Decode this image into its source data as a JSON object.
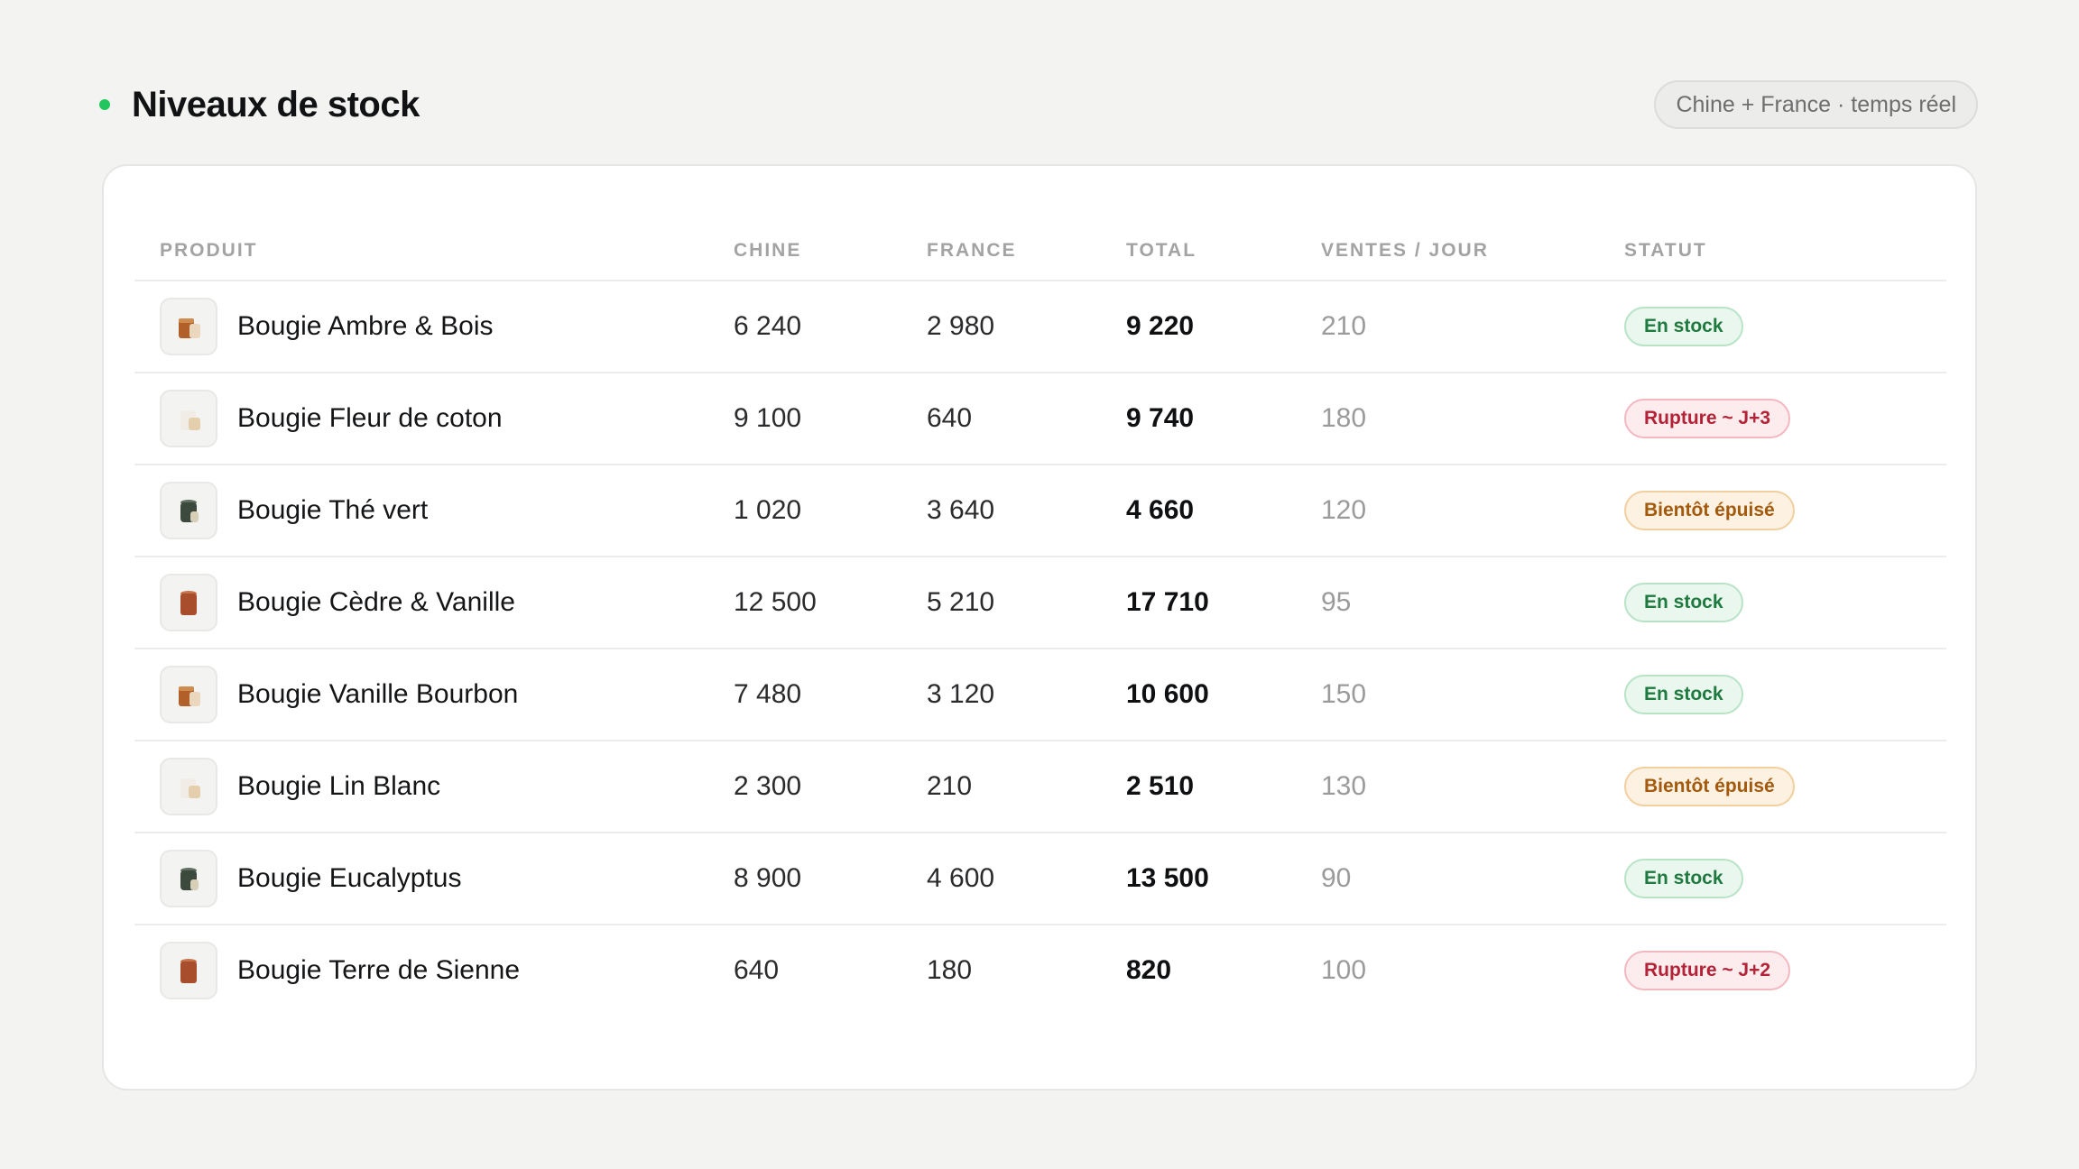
{
  "header": {
    "title": "Niveaux de stock",
    "source_pill": "Chine + France · temps réel",
    "status_dot_color": "#22c55e"
  },
  "table": {
    "columns": {
      "product": "PRODUIT",
      "china": "CHINE",
      "france": "FRANCE",
      "total": "TOTAL",
      "sales_per_day": "VENTES / JOUR",
      "status": "STATUT"
    },
    "rows": [
      {
        "product": "Bougie Ambre & Bois",
        "thumb": "amber",
        "china": "6 240",
        "france": "2 980",
        "total": "9 220",
        "sales": "210",
        "status": "En stock",
        "status_kind": "ok"
      },
      {
        "product": "Bougie Fleur de coton",
        "thumb": "white",
        "china": "9 100",
        "france": "640",
        "total": "9 740",
        "sales": "180",
        "status": "Rupture ~ J+3",
        "status_kind": "out"
      },
      {
        "product": "Bougie Thé vert",
        "thumb": "green",
        "china": "1 020",
        "france": "3 640",
        "total": "4 660",
        "sales": "120",
        "status": "Bientôt épuisé",
        "status_kind": "low"
      },
      {
        "product": "Bougie Cèdre & Vanille",
        "thumb": "terracotta",
        "china": "12 500",
        "france": "5 210",
        "total": "17 710",
        "sales": "95",
        "status": "En stock",
        "status_kind": "ok"
      },
      {
        "product": "Bougie Vanille Bourbon",
        "thumb": "amber",
        "china": "7 480",
        "france": "3 120",
        "total": "10 600",
        "sales": "150",
        "status": "En stock",
        "status_kind": "ok"
      },
      {
        "product": "Bougie Lin Blanc",
        "thumb": "white",
        "china": "2 300",
        "france": "210",
        "total": "2 510",
        "sales": "130",
        "status": "Bientôt épuisé",
        "status_kind": "low"
      },
      {
        "product": "Bougie Eucalyptus",
        "thumb": "green",
        "china": "8 900",
        "france": "4 600",
        "total": "13 500",
        "sales": "90",
        "status": "En stock",
        "status_kind": "ok"
      },
      {
        "product": "Bougie Terre de Sienne",
        "thumb": "terracotta",
        "china": "640",
        "france": "180",
        "total": "820",
        "sales": "100",
        "status": "Rupture ~ J+2",
        "status_kind": "out"
      }
    ]
  },
  "colors": {
    "ok": "#1f7a3f",
    "out": "#b32236",
    "low": "#a35a0c"
  }
}
